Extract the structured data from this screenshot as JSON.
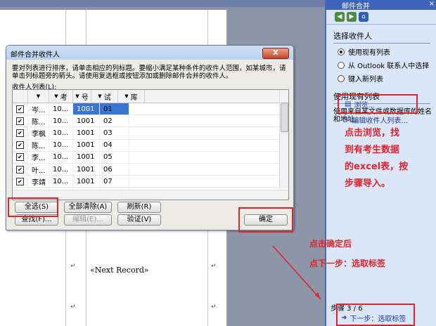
{
  "task_pane": {
    "title": "邮件合并",
    "close": "×",
    "section_select": "选择收件人",
    "radio_options": [
      {
        "label": "使用现有列表",
        "checked": true
      },
      {
        "label": "从 Outlook 联系人中选择",
        "checked": false
      },
      {
        "label": "键入新列表",
        "checked": false
      }
    ],
    "section_use": "使用现有列表",
    "description": "使用来自某文件或数据库的姓名和地址。",
    "browse_link": "浏览...",
    "edit_link": "编辑收件人列表...",
    "step_label": "步骤 3 / 6",
    "next_link": "下一步：选取标签"
  },
  "annotations": {
    "note1": [
      "点击浏览，找",
      "到有考生数据",
      "的excel表，按",
      "步骤导入。"
    ],
    "note2": [
      "点击确定后",
      "点下一步：选取标签"
    ]
  },
  "document": {
    "next_record": "«Next Record»"
  },
  "dialog": {
    "title": "邮件合并收件人",
    "close": "X",
    "description": "要对列表进行排序，请单击相应的列标题。要缩小满足某种条件的收件人范围，如某城市，请单击列标题旁的箭头。请使用复选框或按钮添加或删除邮件合并的收件人。",
    "list_label": "收件人列表(L):",
    "columns": [
      "",
      "",
      "考",
      "号",
      "试",
      "库"
    ],
    "rows": [
      {
        "checked": true,
        "c2": "岑...",
        "c3": "10...",
        "c4": "1001",
        "c5": "01",
        "selected": true
      },
      {
        "checked": true,
        "c2": "陈...",
        "c3": "10...",
        "c4": "1001",
        "c5": "02",
        "selected": false
      },
      {
        "checked": true,
        "c2": "李枫",
        "c3": "10...",
        "c4": "1001",
        "c5": "03",
        "selected": false
      },
      {
        "checked": true,
        "c2": "陈...",
        "c3": "10...",
        "c4": "1001",
        "c5": "04",
        "selected": false
      },
      {
        "checked": true,
        "c2": "李...",
        "c3": "10...",
        "c4": "1001",
        "c5": "05",
        "selected": false
      },
      {
        "checked": true,
        "c2": "叶...",
        "c3": "10...",
        "c4": "1001",
        "c5": "06",
        "selected": false
      },
      {
        "checked": true,
        "c2": "李靖",
        "c3": "10...",
        "c4": "1001",
        "c5": "07",
        "selected": false
      },
      {
        "checked": true,
        "c2": "李...",
        "c3": "10...",
        "c4": "1001",
        "c5": "08",
        "selected": false
      }
    ],
    "buttons": {
      "select_all": "全选(S)",
      "clear_all": "全部清除(A)",
      "refresh": "刷新(R)",
      "find": "查找(F)...",
      "edit": "编辑(E)...",
      "validate": "验证(V)",
      "ok": "确定"
    }
  }
}
